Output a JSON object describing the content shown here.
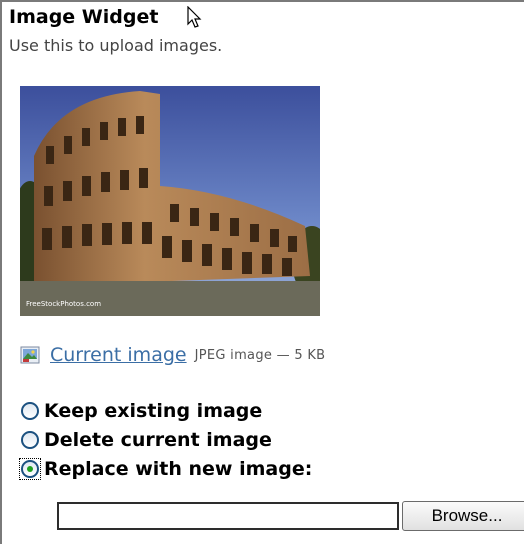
{
  "widget": {
    "title": "Image Widget",
    "description": "Use this to upload images."
  },
  "preview": {
    "alt": "Colosseum photo",
    "watermark": "FreeStockPhotos.com"
  },
  "current_file": {
    "icon": "image-file-icon",
    "link_label": "Current image",
    "meta": "JPEG image — 5 KB"
  },
  "options": [
    {
      "label": "Keep existing image",
      "checked": false
    },
    {
      "label": "Delete current image",
      "checked": false
    },
    {
      "label": "Replace with new image:",
      "checked": true
    }
  ],
  "upload": {
    "value": "",
    "browse_label": "Browse..."
  },
  "colors": {
    "link": "#3b6ea5",
    "radio_border": "#1c5180",
    "radio_selected": "#21a121"
  }
}
